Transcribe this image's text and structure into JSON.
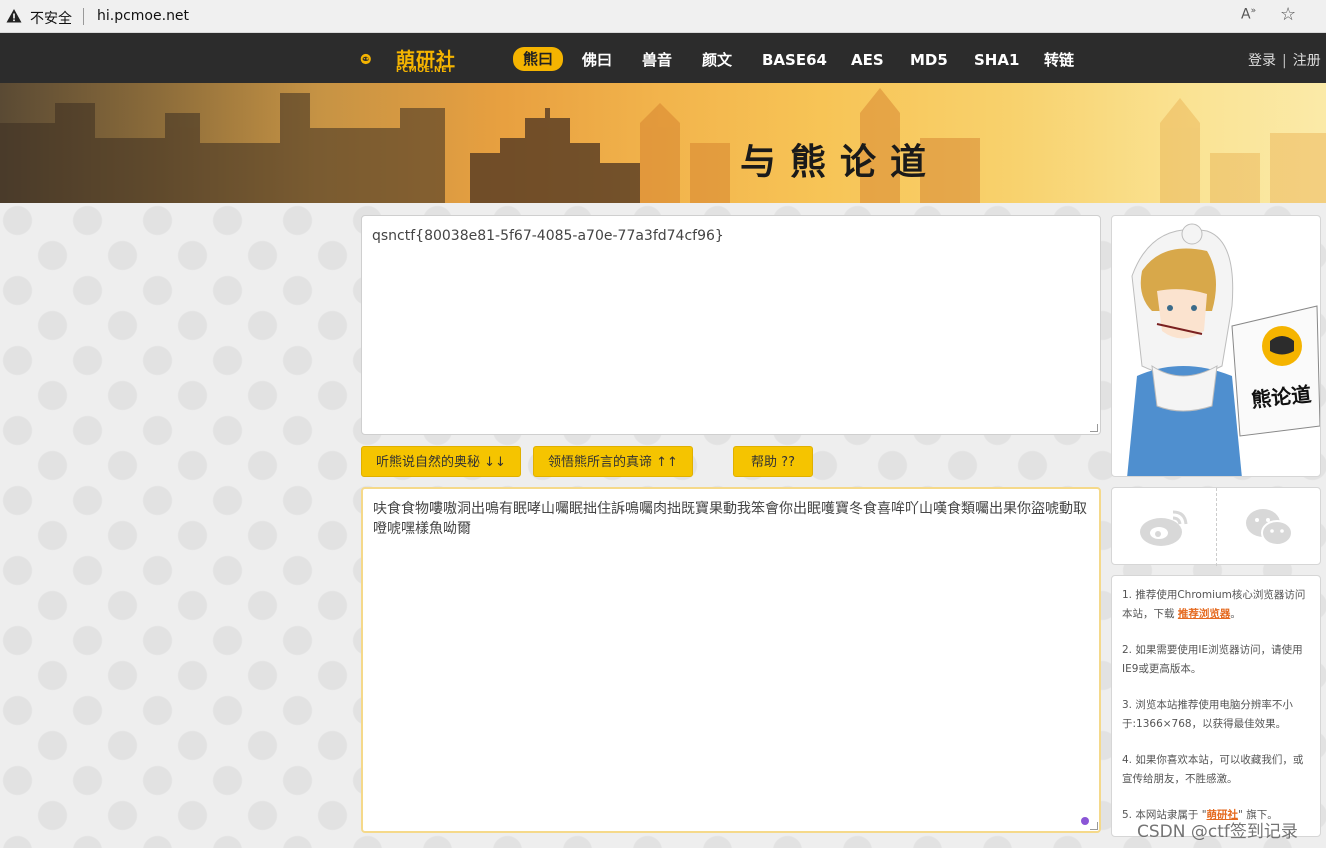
{
  "browser": {
    "security_label": "不安全",
    "url": "hi.pcmoe.net"
  },
  "site": {
    "logo_text": "萌研社",
    "logo_sub": "PCMOE.NET",
    "nav": [
      "熊曰",
      "佛曰",
      "兽音",
      "颜文",
      "BASE64",
      "AES",
      "MD5",
      "SHA1",
      "转链"
    ],
    "login": "登录",
    "separator": "|",
    "register": "注册"
  },
  "banner": {
    "title": "与熊论道"
  },
  "main": {
    "input_text": "qsnctf{80038e81-5f67-4085-a70e-77a3fd74cf96}",
    "buttons": {
      "encode": "听熊说自然的奥秘 ↓↓",
      "decode": "领悟熊所言的真谛 ↑↑",
      "help": "帮助 ??"
    },
    "output_text": "呋食食物嘍嗷洞出鳴有眠哮山囑眠拙住訴鳴囑肉拙既寶果動我笨會你出眠嚄寶冬食喜哞吖山嘆食類囑出果你盜唬動取噔唬嘿樣魚呦爾"
  },
  "sidebar": {
    "sign_text": "熊论道",
    "notes": {
      "n1_a": "1. 推荐使用Chromium核心浏览器访问本站，下载 ",
      "n1_link": "推荐浏览器",
      "n1_b": "。",
      "n2": "2. 如果需要使用IE浏览器访问，请使用IE9或更高版本。",
      "n3": "3. 浏览本站推荐使用电脑分辨率不小于:1366×768，以获得最佳效果。",
      "n4": "4. 如果你喜欢本站，可以收藏我们，或宣传给朋友，不胜感激。",
      "n5_a": "5. 本网站隶属于 \"",
      "n5_link": "萌研社",
      "n5_b": "\" 旗下。"
    }
  },
  "watermark": "CSDN @ctf签到记录",
  "colors": {
    "accent": "#f5c400",
    "nav_bg": "#2c2c2c",
    "link": "#e56a1f"
  }
}
